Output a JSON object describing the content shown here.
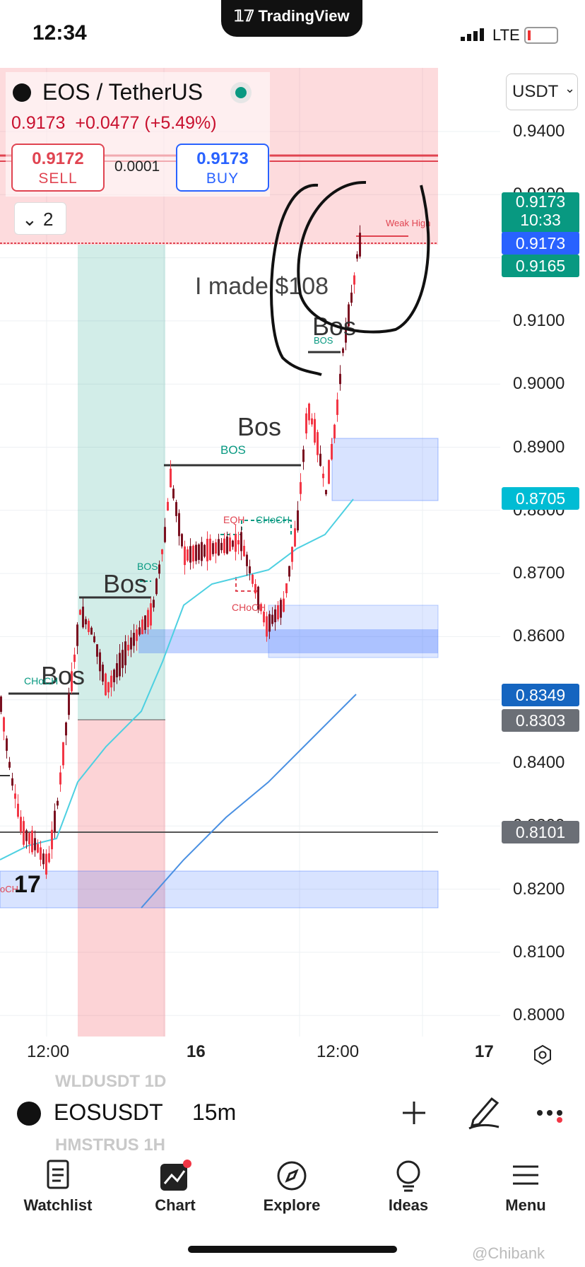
{
  "status": {
    "time": "12:34",
    "carrier": "TradingView",
    "network": "LTE"
  },
  "header": {
    "symbol": "EOS / TetherUS",
    "last_price": "0.9173",
    "change": "+0.0477",
    "change_pct": "(+5.49%)",
    "sell_price": "0.9172",
    "sell_label": "SELL",
    "spread": "0.0001",
    "buy_price": "0.9173",
    "buy_label": "BUY",
    "indicators_count": "2",
    "currency": "USDT"
  },
  "price_axis": {
    "ticks": [
      "0.9400",
      "0.9300",
      "0.9200",
      "0.9100",
      "0.9000",
      "0.8900",
      "0.8800",
      "0.8700",
      "0.8600",
      "0.8500",
      "0.8400",
      "0.8300",
      "0.8200",
      "0.8100",
      "0.8000"
    ],
    "tags": [
      {
        "value": "0.9173",
        "sub": "10:33",
        "color": "#089981"
      },
      {
        "value": "0.9173",
        "color": "#2962ff"
      },
      {
        "value": "0.9165",
        "color": "#089981"
      },
      {
        "value": "0.8705",
        "color": "#00bcd4"
      },
      {
        "value": "0.8349",
        "color": "#1565c0"
      },
      {
        "value": "0.8303",
        "color": "#6b6f76"
      },
      {
        "value": "0.8101",
        "color": "#6b6f76"
      }
    ]
  },
  "time_axis": {
    "labels": [
      "12:00",
      "16",
      "12:00",
      "17"
    ]
  },
  "annotations": {
    "bos": "Bos",
    "bos_small": "BOS",
    "choch": "CHoCH",
    "eqh": "EQH",
    "weak_high": "Weak High",
    "choch_partial": "oCH",
    "handwritten": "I made $108"
  },
  "toolbar": {
    "symbol": "EOSUSDT",
    "interval": "15m",
    "ghost_above": "WLDUSDT   1D",
    "ghost_below": "HMSTRUS   1H"
  },
  "nav": [
    "Watchlist",
    "Chart",
    "Explore",
    "Ideas",
    "Menu"
  ],
  "watermark": "@Chibank",
  "colors": {
    "up": "#089981",
    "down": "#f23645",
    "accent": "#2962ff"
  }
}
